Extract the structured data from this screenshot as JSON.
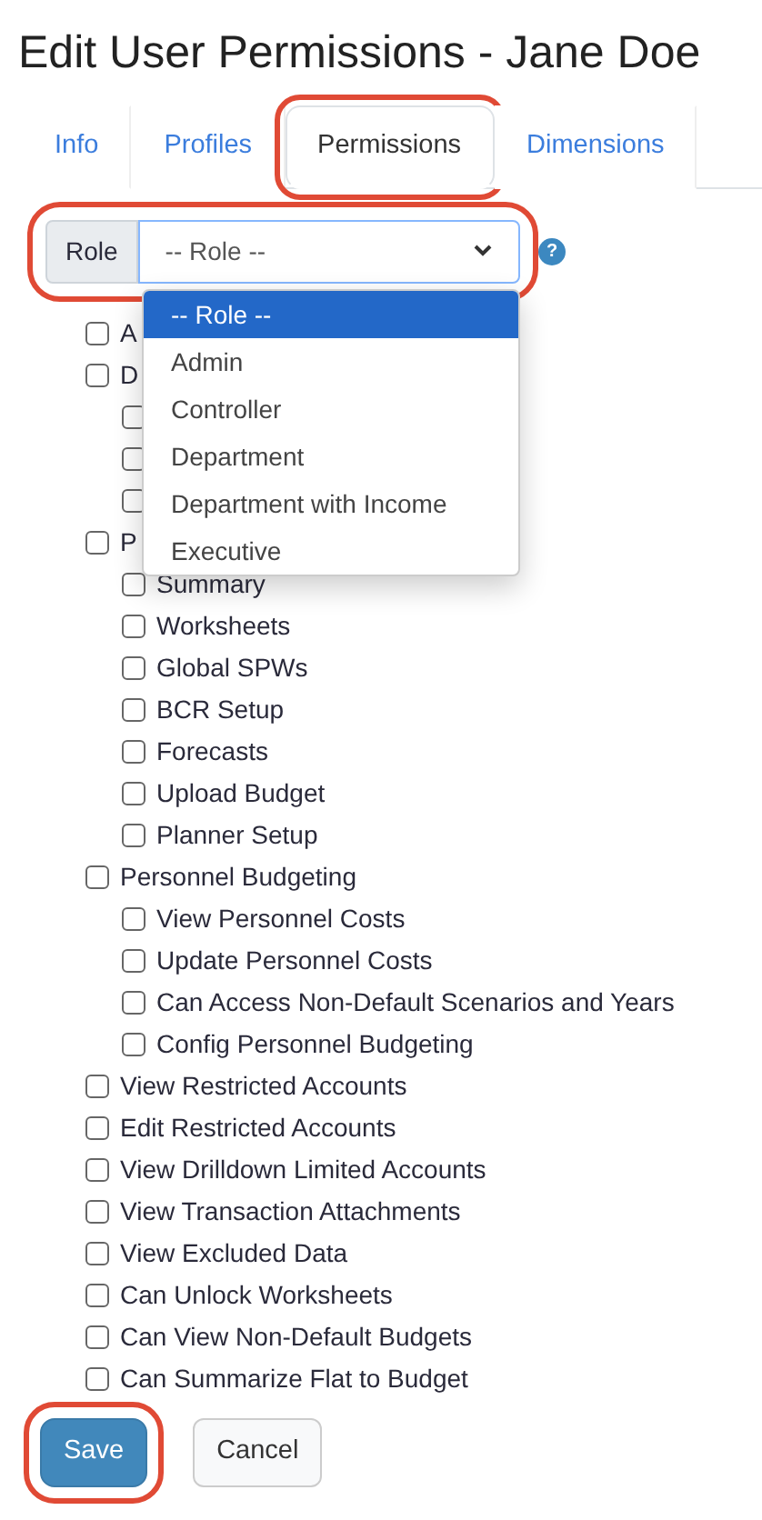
{
  "title": "Edit User Permissions - Jane Doe",
  "tabs": [
    {
      "label": "Info",
      "selected": false,
      "highlighted": false
    },
    {
      "label": "Profiles",
      "selected": false,
      "highlighted": false
    },
    {
      "label": "Permissions",
      "selected": true,
      "highlighted": true
    },
    {
      "label": "Dimensions",
      "selected": false,
      "highlighted": false
    }
  ],
  "role_filter": {
    "label": "Role",
    "value": "-- Role --",
    "help": "?",
    "highlighted": true,
    "expanded": true,
    "options": [
      {
        "label": "-- Role --",
        "selected": true
      },
      {
        "label": "Admin",
        "selected": false
      },
      {
        "label": "Controller",
        "selected": false
      },
      {
        "label": "Department",
        "selected": false
      },
      {
        "label": "Department with Income",
        "selected": false
      },
      {
        "label": "Executive",
        "selected": false
      }
    ]
  },
  "permissions": [
    {
      "label": "A",
      "checked": false
    },
    {
      "label": "D",
      "checked": false,
      "children": [
        {
          "checked": false
        },
        {
          "checked": false
        },
        {
          "checked": false
        }
      ]
    },
    {
      "label": "P",
      "checked": false,
      "children": [
        {
          "label": "Summary",
          "checked": false
        },
        {
          "label": "Worksheets",
          "checked": false
        },
        {
          "label": "Global SPWs",
          "checked": false
        },
        {
          "label": "BCR Setup",
          "checked": false
        },
        {
          "label": "Forecasts",
          "checked": false
        },
        {
          "label": "Upload Budget",
          "checked": false
        },
        {
          "label": "Planner Setup",
          "checked": false
        }
      ]
    },
    {
      "label": "Personnel Budgeting",
      "checked": false,
      "children": [
        {
          "label": "View Personnel Costs",
          "checked": false
        },
        {
          "label": "Update Personnel Costs",
          "checked": false
        },
        {
          "label": "Can Access Non-Default Scenarios and Years",
          "checked": false
        },
        {
          "label": "Config Personnel Budgeting",
          "checked": false
        }
      ]
    },
    {
      "label": "View Restricted Accounts",
      "checked": false
    },
    {
      "label": "Edit Restricted Accounts",
      "checked": false
    },
    {
      "label": "View Drilldown Limited Accounts",
      "checked": false
    },
    {
      "label": "View Transaction Attachments",
      "checked": false
    },
    {
      "label": "View Excluded Data",
      "checked": false
    },
    {
      "label": "Can Unlock Worksheets",
      "checked": false
    },
    {
      "label": "Can View Non-Default Budgets",
      "checked": false
    },
    {
      "label": "Can Summarize Flat to Budget",
      "checked": false
    }
  ],
  "buttons": [
    {
      "label": "Save",
      "kind": "primary",
      "highlighted": true
    },
    {
      "label": "Cancel",
      "kind": "secondary",
      "highlighted": false
    }
  ]
}
